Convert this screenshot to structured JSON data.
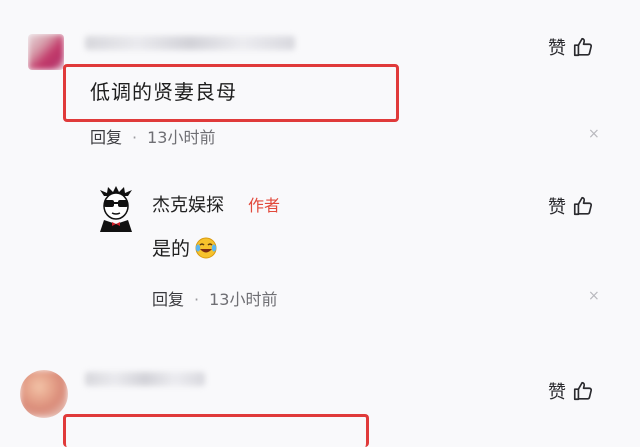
{
  "comments": [
    {
      "text": "低调的贤妻良母",
      "time": "13小时前",
      "reply_label": "回复",
      "like_label": "赞"
    },
    {
      "author": "杰克娱探",
      "author_tag": "作者",
      "text": "是的",
      "time": "13小时前",
      "reply_label": "回复",
      "like_label": "赞"
    },
    {
      "text": "",
      "like_label": "赞"
    }
  ],
  "icons": {
    "like": "thumbs-up-icon",
    "close": "close-icon",
    "emoji": "laughing-crying-emoji-icon"
  },
  "colors": {
    "highlight_box": "#e03a3a",
    "author_tag": "#e24a3c",
    "meta_text": "#6f6f74"
  },
  "meta_separator": "·",
  "close_glyph": "×"
}
